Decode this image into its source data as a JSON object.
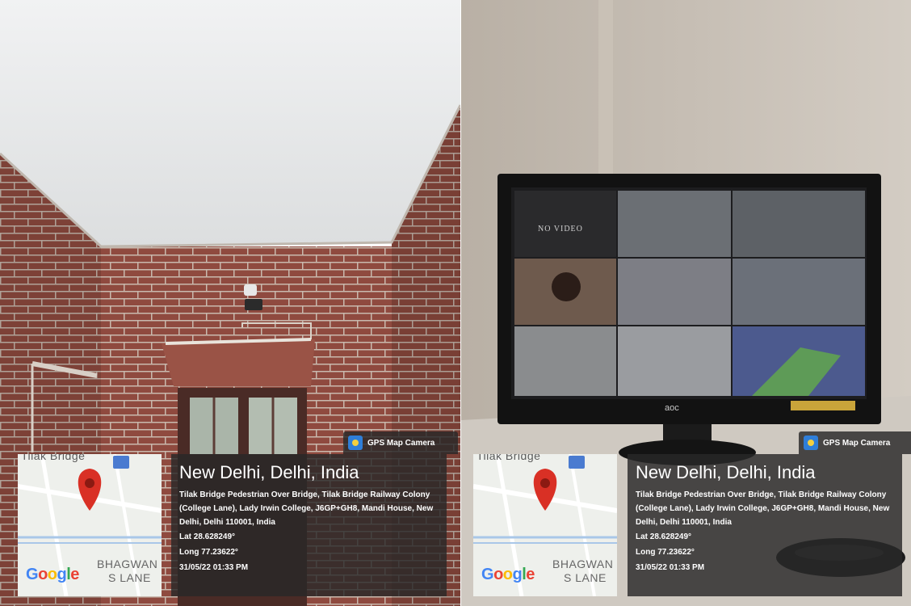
{
  "overlay": {
    "app_badge": "GPS Map Camera",
    "city": "New Delhi, Delhi, India",
    "address": "Tilak Bridge Pedestrian Over Bridge, Tilak Bridge Railway Colony (College Lane), Lady Irwin College, J6GP+GH8, Mandi House, New Delhi, Delhi 110001, India",
    "lat": "Lat 28.628249°",
    "long": "Long 77.23622°",
    "datetime": "31/05/22 01:33 PM"
  },
  "map": {
    "top_label": "Tilak Bridge",
    "place_label_1": "BHAGWAN",
    "place_label_2": "S LANE",
    "google_letters": [
      "G",
      "o",
      "o",
      "g",
      "l",
      "e"
    ],
    "google_colors": [
      "#4285F4",
      "#EA4335",
      "#FBBC05",
      "#4285F4",
      "#34A853",
      "#EA4335"
    ],
    "pin_color": "#d93025"
  },
  "monitor": {
    "no_video_label": "NO VIDEO",
    "brand": "aoc"
  }
}
